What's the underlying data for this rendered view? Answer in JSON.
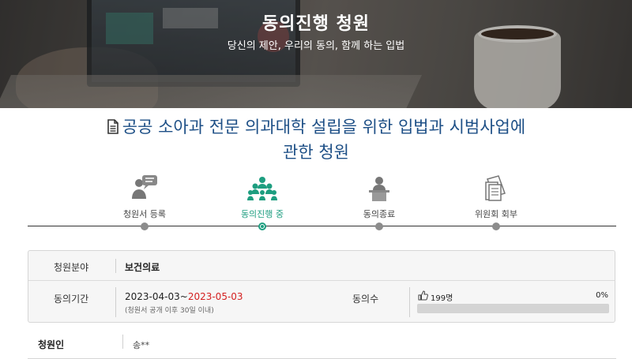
{
  "hero": {
    "title": "동의진행 청원",
    "subtitle": "당신의 제안, 우리의 동의, 함께 하는 입법"
  },
  "petition": {
    "title_line1": "공공 소아과 전문 의과대학 설립을 위한 입법과 시범사업에",
    "title_line2": "관한 청원",
    "title_icon": "document-icon"
  },
  "steps": [
    {
      "label": "청원서 등록",
      "icon": "register-icon",
      "active": false
    },
    {
      "label": "동의진행 중",
      "icon": "people-group-icon",
      "active": true
    },
    {
      "label": "동의종료",
      "icon": "podium-person-icon",
      "active": false
    },
    {
      "label": "위원회 회부",
      "icon": "documents-stack-icon",
      "active": false
    }
  ],
  "info": {
    "field_label": "청원분야",
    "field_value": "보건의료",
    "period_label": "동의기간",
    "period_start": "2023-04-03",
    "period_separator": "~",
    "period_end": "2023-05-03",
    "period_note": "(청원서 공개 이후 30일 이내)",
    "votes_label": "동의수",
    "votes_count": "199명",
    "votes_percent": "0%",
    "votes_progress": 0.0
  },
  "petitioner": {
    "label": "청원인",
    "value": "송**"
  },
  "colors": {
    "accent": "#1e9e80",
    "title_blue": "#1d4f86",
    "deadline_red": "#d42020"
  }
}
